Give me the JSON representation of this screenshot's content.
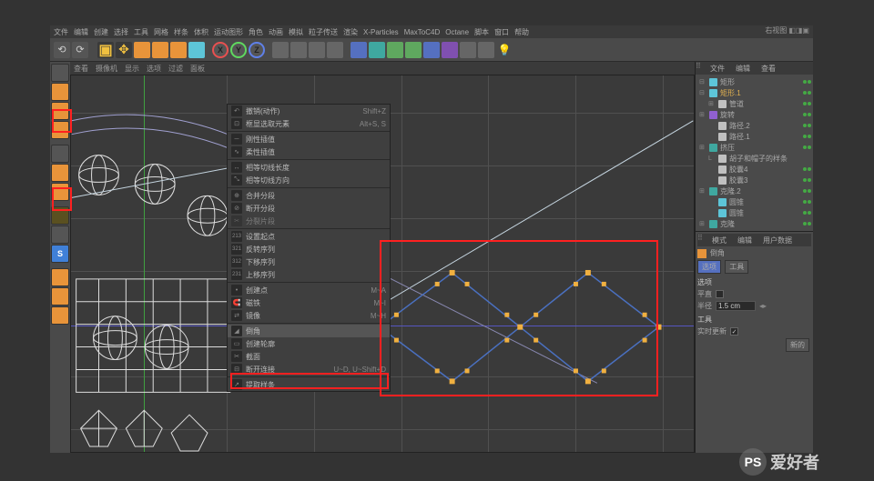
{
  "menu": [
    "文件",
    "编辑",
    "创建",
    "选择",
    "工具",
    "网格",
    "样条",
    "体积",
    "运动图形",
    "角色",
    "动画",
    "模拟",
    "粒子传送",
    "渲染",
    "X-Particles",
    "MaxToC4D",
    "Octane",
    "脚本",
    "窗口",
    "帮助"
  ],
  "axes": {
    "x": "X",
    "y": "Y",
    "z": "Z"
  },
  "viewport_menu": [
    "查看",
    "摄像机",
    "显示",
    "选项",
    "过滤",
    "面板"
  ],
  "viewport_label": "右视图",
  "context": [
    {
      "label": "撤销(动作)",
      "shortcut": "Shift+Z"
    },
    {
      "label": "框显选取元素",
      "shortcut": "Alt+S, S"
    },
    {
      "sep": true
    },
    {
      "label": "刚性插值"
    },
    {
      "label": "柔性插值"
    },
    {
      "sep": true
    },
    {
      "label": "相等切线长度"
    },
    {
      "label": "相等切线方向"
    },
    {
      "sep": true
    },
    {
      "label": "合并分段"
    },
    {
      "label": "断开分段"
    },
    {
      "label": "分裂片段"
    },
    {
      "sep": true
    },
    {
      "label": "设置起点"
    },
    {
      "label": "反转序列"
    },
    {
      "label": "下移序列"
    },
    {
      "label": "上移序列"
    },
    {
      "sep": true
    },
    {
      "label": "创建点",
      "shortcut": "M~A"
    },
    {
      "label": "磁铁",
      "shortcut": "M~I"
    },
    {
      "label": "镜像",
      "shortcut": "M~H"
    },
    {
      "sep": true
    },
    {
      "label": "倒角",
      "highlight": true
    },
    {
      "label": "创建轮廓"
    },
    {
      "label": "截面"
    },
    {
      "label": "断开连接",
      "shortcut": "U~D, U~Shift+D"
    },
    {
      "sep": true
    },
    {
      "label": "提取样条"
    }
  ],
  "right_tabs": [
    "文件",
    "编辑",
    "查看"
  ],
  "tree": [
    {
      "icon": "cyan",
      "label": "矩形",
      "indent": 0,
      "exp": "⊟"
    },
    {
      "icon": "cyan",
      "label": "矩形.1",
      "indent": 0,
      "exp": "⊟"
    },
    {
      "icon": "white",
      "label": "管道",
      "indent": 1,
      "exp": "⊞"
    },
    {
      "icon": "purple",
      "label": "旋转",
      "indent": 0,
      "exp": "⊞"
    },
    {
      "icon": "white",
      "label": "路径.2",
      "indent": 1,
      "exp": ""
    },
    {
      "icon": "white",
      "label": "路径.1",
      "indent": 1,
      "exp": ""
    },
    {
      "icon": "teal",
      "label": "挤压",
      "indent": 0,
      "exp": "⊞"
    },
    {
      "icon": "white",
      "label": "胡子和帽子的样条",
      "indent": 1,
      "exp": "L"
    },
    {
      "icon": "white",
      "label": "胶囊4",
      "indent": 1,
      "exp": ""
    },
    {
      "icon": "white",
      "label": "胶囊3",
      "indent": 1,
      "exp": ""
    },
    {
      "icon": "teal",
      "label": "克隆.2",
      "indent": 0,
      "exp": "⊞"
    },
    {
      "icon": "cyan",
      "label": "圆锥",
      "indent": 1,
      "exp": ""
    },
    {
      "icon": "cyan",
      "label": "圆锥",
      "indent": 1,
      "exp": ""
    },
    {
      "icon": "teal",
      "label": "克隆",
      "indent": 0,
      "exp": "⊞"
    }
  ],
  "attr_tabs": [
    "模式",
    "编辑",
    "用户数据"
  ],
  "attr_title": "倒角",
  "attr_btns": [
    "选项",
    "工具"
  ],
  "attr_section": "选项",
  "attr_rows": [
    {
      "label": "平直",
      "value": ""
    },
    {
      "label": "半径",
      "value": "1.5 cm"
    }
  ],
  "tools_label": "工具",
  "realtime_label": "实时更新",
  "apply_label": "新的",
  "watermark": {
    "brand": "PS",
    "cn": "爱好者"
  }
}
